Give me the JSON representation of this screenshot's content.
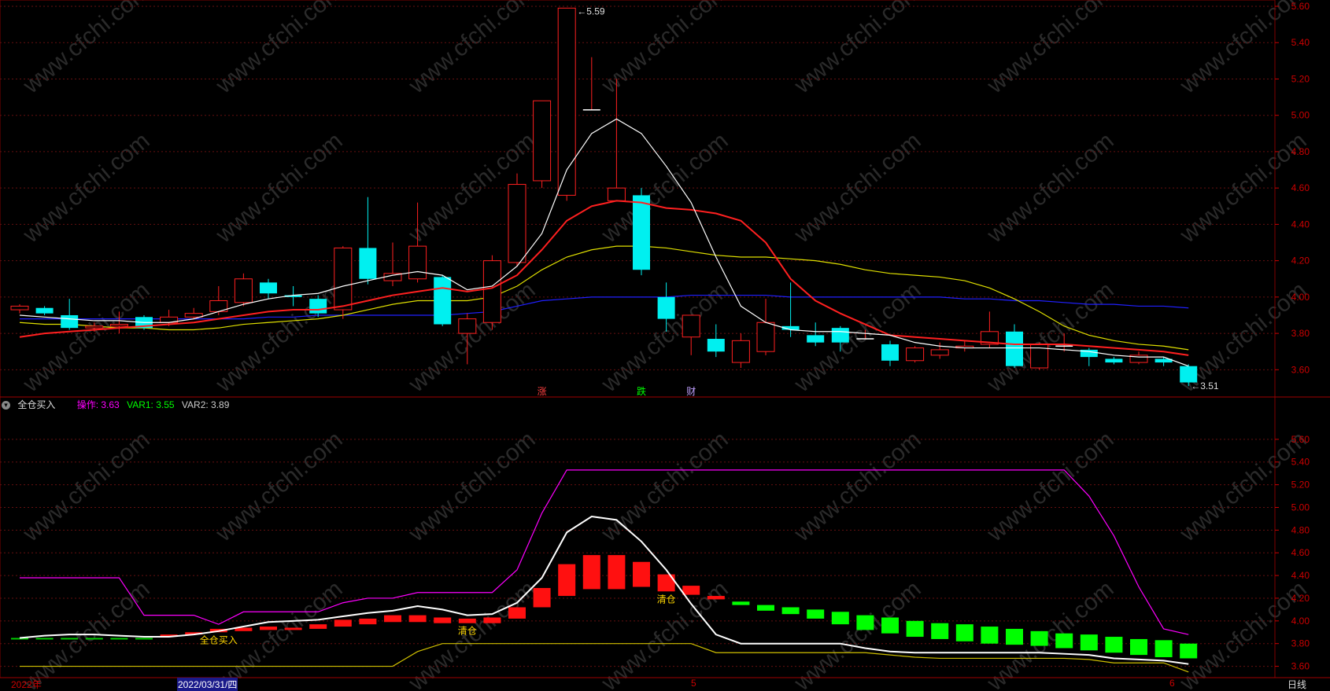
{
  "colors": {
    "up": "#ff2020",
    "down": "#00f0f0",
    "ma5": "#ffffff",
    "ma10": "#ff2020",
    "ma20": "#e0e000",
    "ma60": "#2020ff",
    "axis": "#cc0000",
    "op": "#ff00ff",
    "var1": "#00ff00",
    "var2": "#cccccc"
  },
  "chart_data": [
    {
      "type": "candlestick",
      "ylim": [
        3.45,
        5.6
      ],
      "yticks": [
        "3.60",
        "3.80",
        "4.00",
        "4.20",
        "4.40",
        "4.60",
        "4.80",
        "5.00",
        "5.20",
        "5.40",
        "5.60"
      ],
      "candles": [
        [
          3.93,
          3.95,
          3.91,
          3.96
        ],
        [
          3.94,
          3.91,
          3.9,
          3.95
        ],
        [
          3.9,
          3.83,
          3.82,
          3.99
        ],
        [
          3.83,
          3.84,
          3.81,
          3.86
        ],
        [
          3.84,
          3.85,
          3.8,
          3.92
        ],
        [
          3.89,
          3.83,
          3.82,
          3.9
        ],
        [
          3.86,
          3.89,
          3.84,
          3.93
        ],
        [
          3.89,
          3.91,
          3.88,
          3.94
        ],
        [
          3.92,
          3.98,
          3.9,
          4.06
        ],
        [
          3.97,
          4.1,
          3.95,
          4.13
        ],
        [
          4.08,
          4.02,
          3.99,
          4.1
        ],
        [
          4.01,
          4.0,
          3.95,
          4.06
        ],
        [
          3.99,
          3.91,
          3.89,
          4.01
        ],
        [
          3.93,
          4.27,
          3.88,
          4.28
        ],
        [
          4.27,
          4.1,
          4.07,
          4.55
        ],
        [
          4.09,
          4.13,
          4.06,
          4.3
        ],
        [
          4.1,
          4.28,
          4.08,
          4.52
        ],
        [
          4.11,
          3.85,
          3.84,
          4.12
        ],
        [
          3.8,
          3.88,
          3.63,
          3.91
        ],
        [
          3.86,
          4.2,
          3.82,
          4.23
        ],
        [
          4.19,
          4.62,
          4.17,
          4.68
        ],
        [
          4.64,
          5.08,
          4.6,
          5.08
        ],
        [
          4.56,
          5.59,
          4.53,
          5.59
        ],
        [
          5.03,
          5.03,
          5.03,
          5.32
        ],
        [
          4.53,
          4.6,
          4.53,
          5.2
        ],
        [
          4.56,
          4.15,
          4.12,
          4.6
        ],
        [
          4.0,
          3.88,
          3.81,
          4.08
        ],
        [
          3.78,
          3.9,
          3.68,
          3.9
        ],
        [
          3.77,
          3.7,
          3.67,
          3.85
        ],
        [
          3.64,
          3.76,
          3.61,
          3.8
        ],
        [
          3.7,
          3.86,
          3.68,
          3.99
        ],
        [
          3.84,
          3.82,
          3.78,
          4.08
        ],
        [
          3.79,
          3.75,
          3.73,
          3.86
        ],
        [
          3.83,
          3.75,
          3.7,
          3.84
        ],
        [
          3.77,
          3.77,
          3.77,
          3.82
        ],
        [
          3.74,
          3.65,
          3.62,
          3.76
        ],
        [
          3.65,
          3.72,
          3.64,
          3.73
        ],
        [
          3.68,
          3.71,
          3.66,
          3.75
        ],
        [
          3.72,
          3.73,
          3.7,
          3.76
        ],
        [
          3.74,
          3.81,
          3.72,
          3.92
        ],
        [
          3.81,
          3.62,
          3.61,
          3.85
        ],
        [
          3.61,
          3.74,
          3.6,
          3.75
        ],
        [
          3.73,
          3.73,
          3.7,
          3.8
        ],
        [
          3.71,
          3.67,
          3.62,
          3.72
        ],
        [
          3.66,
          3.64,
          3.63,
          3.67
        ],
        [
          3.64,
          3.68,
          3.63,
          3.7
        ],
        [
          3.66,
          3.64,
          3.62,
          3.67
        ],
        [
          3.62,
          3.53,
          3.51,
          3.63
        ]
      ],
      "ma5": [
        3.9,
        3.89,
        3.88,
        3.87,
        3.87,
        3.86,
        3.86,
        3.88,
        3.92,
        3.96,
        3.99,
        4.01,
        4.02,
        4.06,
        4.09,
        4.12,
        4.14,
        4.12,
        4.04,
        4.06,
        4.17,
        4.35,
        4.7,
        4.9,
        4.98,
        4.9,
        4.72,
        4.52,
        4.22,
        3.95,
        3.86,
        3.82,
        3.81,
        3.81,
        3.8,
        3.79,
        3.75,
        3.73,
        3.72,
        3.72,
        3.72,
        3.72,
        3.71,
        3.7,
        3.68,
        3.67,
        3.67,
        3.62
      ],
      "ma10": [
        3.78,
        3.8,
        3.81,
        3.82,
        3.83,
        3.84,
        3.85,
        3.86,
        3.88,
        3.9,
        3.92,
        3.93,
        3.93,
        3.95,
        3.98,
        4.01,
        4.03,
        4.05,
        4.03,
        4.05,
        4.12,
        4.26,
        4.42,
        4.5,
        4.53,
        4.52,
        4.49,
        4.48,
        4.46,
        4.42,
        4.3,
        4.1,
        3.98,
        3.91,
        3.85,
        3.79,
        3.78,
        3.77,
        3.76,
        3.75,
        3.74,
        3.74,
        3.74,
        3.73,
        3.72,
        3.71,
        3.7,
        3.68
      ],
      "ma20": [
        3.86,
        3.85,
        3.85,
        3.84,
        3.83,
        3.83,
        3.82,
        3.82,
        3.83,
        3.85,
        3.86,
        3.87,
        3.88,
        3.9,
        3.93,
        3.96,
        3.98,
        3.98,
        3.98,
        4.0,
        4.06,
        4.15,
        4.22,
        4.26,
        4.28,
        4.28,
        4.27,
        4.25,
        4.23,
        4.22,
        4.22,
        4.21,
        4.2,
        4.18,
        4.15,
        4.13,
        4.12,
        4.11,
        4.09,
        4.05,
        3.99,
        3.92,
        3.84,
        3.79,
        3.76,
        3.74,
        3.73,
        3.71
      ],
      "ma60": [
        3.88,
        3.88,
        3.88,
        3.88,
        3.88,
        3.88,
        3.88,
        3.88,
        3.88,
        3.88,
        3.89,
        3.89,
        3.9,
        3.9,
        3.9,
        3.9,
        3.9,
        3.9,
        3.91,
        3.92,
        3.95,
        3.98,
        3.99,
        4.0,
        4.0,
        4.0,
        4.0,
        4.01,
        4.01,
        4.01,
        4.01,
        4.0,
        4.0,
        4.0,
        4.0,
        4.0,
        4.0,
        4.0,
        3.99,
        3.99,
        3.98,
        3.98,
        3.97,
        3.96,
        3.96,
        3.95,
        3.95,
        3.94
      ],
      "annotations": {
        "max": "5.59",
        "min": "3.51"
      },
      "markers": [
        {
          "text": "涨",
          "idx": 21,
          "color": "#ff4040"
        },
        {
          "text": "跌",
          "idx": 25,
          "color": "#00ff00"
        },
        {
          "text": "财",
          "idx": 27,
          "color": "#c0a0ff"
        }
      ]
    },
    {
      "type": "indicator",
      "name": "全仓买入",
      "ylim": [
        3.5,
        5.8
      ],
      "yticks": [
        "3.60",
        "3.80",
        "4.00",
        "4.20",
        "4.40",
        "4.60",
        "4.80",
        "5.00",
        "5.20",
        "5.40",
        "5.60"
      ],
      "legend": [
        {
          "label": "操作: 3.63",
          "color": "#ff00ff"
        },
        {
          "label": "VAR1: 3.55",
          "color": "#00ff00"
        },
        {
          "label": "VAR2: 3.89",
          "color": "#cccccc"
        }
      ],
      "upper": [
        4.38,
        4.38,
        4.38,
        4.38,
        4.38,
        4.05,
        4.05,
        4.05,
        3.97,
        4.08,
        4.08,
        4.08,
        4.08,
        4.16,
        4.2,
        4.2,
        4.25,
        4.25,
        4.25,
        4.25,
        4.45,
        4.95,
        5.33,
        5.33,
        5.33,
        5.33,
        5.33,
        5.33,
        5.33,
        5.33,
        5.33,
        5.33,
        5.33,
        5.33,
        5.33,
        5.33,
        5.33,
        5.33,
        5.33,
        5.33,
        5.33,
        5.33,
        5.33,
        5.1,
        4.75,
        4.3,
        3.93,
        3.88
      ],
      "lower": [
        3.6,
        3.6,
        3.6,
        3.6,
        3.6,
        3.6,
        3.6,
        3.6,
        3.6,
        3.6,
        3.6,
        3.6,
        3.6,
        3.6,
        3.6,
        3.6,
        3.73,
        3.8,
        3.8,
        3.8,
        3.8,
        3.8,
        3.8,
        3.8,
        3.8,
        3.8,
        3.8,
        3.8,
        3.72,
        3.72,
        3.72,
        3.72,
        3.72,
        3.72,
        3.72,
        3.7,
        3.68,
        3.67,
        3.67,
        3.67,
        3.67,
        3.67,
        3.67,
        3.66,
        3.63,
        3.63,
        3.63,
        3.55
      ],
      "mid": [
        3.85,
        3.87,
        3.88,
        3.88,
        3.87,
        3.86,
        3.86,
        3.88,
        3.91,
        3.95,
        3.99,
        4.0,
        4.01,
        4.04,
        4.07,
        4.09,
        4.13,
        4.1,
        4.05,
        4.06,
        4.16,
        4.38,
        4.78,
        4.92,
        4.89,
        4.7,
        4.45,
        4.15,
        3.88,
        3.8,
        3.8,
        3.8,
        3.8,
        3.8,
        3.76,
        3.73,
        3.72,
        3.72,
        3.72,
        3.72,
        3.72,
        3.72,
        3.71,
        3.7,
        3.67,
        3.66,
        3.65,
        3.62
      ],
      "bars": [
        [
          3.84,
          3.85
        ],
        [
          3.84,
          3.85
        ],
        [
          3.84,
          3.85
        ],
        [
          3.84,
          3.85
        ],
        [
          3.84,
          3.85
        ],
        [
          3.84,
          3.85
        ],
        [
          3.87,
          3.88
        ],
        [
          3.88,
          3.9
        ],
        [
          3.9,
          3.93
        ],
        [
          3.91,
          3.94
        ],
        [
          3.92,
          3.95
        ],
        [
          3.92,
          3.94
        ],
        [
          3.93,
          3.97
        ],
        [
          3.95,
          4.01
        ],
        [
          3.97,
          4.02
        ],
        [
          3.99,
          4.05
        ],
        [
          3.99,
          4.05
        ],
        [
          3.98,
          4.03
        ],
        [
          3.98,
          4.02
        ],
        [
          3.98,
          4.03
        ],
        [
          4.02,
          4.12
        ],
        [
          4.12,
          4.29
        ],
        [
          4.22,
          4.5
        ],
        [
          4.28,
          4.58
        ],
        [
          4.28,
          4.58
        ],
        [
          4.3,
          4.52
        ],
        [
          4.26,
          4.41
        ],
        [
          4.23,
          4.31
        ],
        [
          4.19,
          4.22
        ],
        [
          4.14,
          4.17
        ],
        [
          4.09,
          4.14
        ],
        [
          4.06,
          4.12
        ],
        [
          4.02,
          4.1
        ],
        [
          3.97,
          4.08
        ],
        [
          3.92,
          4.05
        ],
        [
          3.89,
          4.03
        ],
        [
          3.86,
          4.0
        ],
        [
          3.84,
          3.98
        ],
        [
          3.82,
          3.97
        ],
        [
          3.8,
          3.95
        ],
        [
          3.79,
          3.93
        ],
        [
          3.78,
          3.91
        ],
        [
          3.76,
          3.89
        ],
        [
          3.74,
          3.88
        ],
        [
          3.72,
          3.86
        ],
        [
          3.7,
          3.84
        ],
        [
          3.68,
          3.83
        ],
        [
          3.67,
          3.8
        ]
      ],
      "bar_red_count": 29,
      "annotations": [
        {
          "text": "全仓买入",
          "idx": 8,
          "color": "#ffd700"
        },
        {
          "text": "清仓",
          "idx": 18,
          "color": "#ffd700"
        },
        {
          "text": "清仓",
          "idx": 26,
          "color": "#ffd700"
        }
      ]
    }
  ],
  "date_axis": [
    {
      "text": "2022年",
      "pos": 0.008,
      "selected": false
    },
    {
      "text": "2022/03/31/四",
      "pos": 0.124,
      "selected": true
    },
    {
      "text": "5",
      "pos": 0.481,
      "selected": false
    },
    {
      "text": "6",
      "pos": 0.815,
      "selected": false
    }
  ],
  "period_label": "日线",
  "watermark": "www.cfchi.com"
}
